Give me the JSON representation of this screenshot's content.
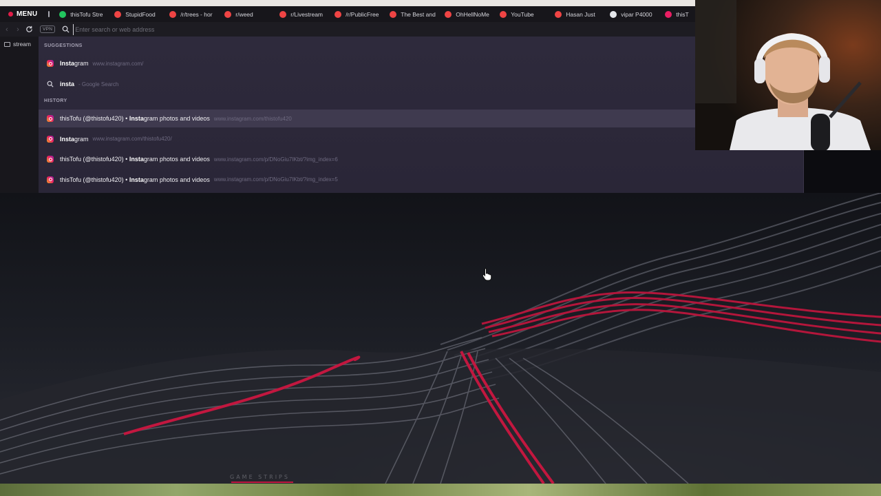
{
  "browser": {
    "menu_label": "MENU",
    "tabs": [
      {
        "title": "thisTofu Stre",
        "favicon": "twitch-icon",
        "color": "#22c55e"
      },
      {
        "title": "StupidFood",
        "favicon": "reddit-icon",
        "color": "#ef4444"
      },
      {
        "title": "/r/trees - hor",
        "favicon": "reddit-icon",
        "color": "#ef4444"
      },
      {
        "title": "r/weed",
        "favicon": "reddit-icon",
        "color": "#ef4444"
      },
      {
        "title": "r/Livestream",
        "favicon": "reddit-icon",
        "color": "#ef4444"
      },
      {
        "title": "/r/PublicFree",
        "favicon": "reddit-icon",
        "color": "#ef4444"
      },
      {
        "title": "The Best and",
        "favicon": "reddit-icon",
        "color": "#ef4444"
      },
      {
        "title": "OhHellNoMe",
        "favicon": "reddit-icon",
        "color": "#ef4444"
      },
      {
        "title": "YouTube",
        "favicon": "youtube-icon",
        "color": "#ef4444"
      },
      {
        "title": "Hasan Just",
        "favicon": "youtube-icon",
        "color": "#ef4444"
      },
      {
        "title": "vipar P4000",
        "favicon": "google-icon",
        "color": "#e5e7eb"
      },
      {
        "title": "thisT",
        "favicon": "instagram-icon",
        "color": "#e91e63"
      }
    ],
    "address": {
      "vpn_label": "VPN",
      "placeholder": "Enter search or web address",
      "value": ""
    },
    "sidebar": {
      "bookmark_label": "stream"
    }
  },
  "dropdown": {
    "suggestions_header": "SUGGESTIONS",
    "history_header": "HISTORY",
    "suggestions": [
      {
        "bold": "Insta",
        "rest": "gram",
        "url": "www.instagram.com/",
        "icon": "instagram-icon"
      },
      {
        "bold": "insta",
        "rest": "",
        "url": "- Google Search",
        "icon": "search-icon"
      }
    ],
    "history": [
      {
        "pre": "thisTofu (@thistofu420) • ",
        "bold": "Insta",
        "rest": "gram photos and videos",
        "url": "www.instagram.com/thistofu420",
        "icon": "instagram-icon",
        "highlighted": true
      },
      {
        "pre": "",
        "bold": "Insta",
        "rest": "gram",
        "url": "www.instagram.com/thistofu420/",
        "icon": "instagram-icon",
        "highlighted": false
      },
      {
        "pre": "thisTofu (@thistofu420) • ",
        "bold": "Insta",
        "rest": "gram photos and videos",
        "url": "www.instagram.com/p/DNoGiu7IKbt/?img_index=6",
        "icon": "instagram-icon",
        "highlighted": false
      },
      {
        "pre": "thisTofu (@thistofu420) • ",
        "bold": "Insta",
        "rest": "gram photos and videos",
        "url": "www.instagram.com/p/DNoGiu7IKbt/?img_index=5",
        "icon": "instagram-icon",
        "highlighted": false
      }
    ]
  },
  "desktop": {
    "wallpaper_caption": "GAME STRIPS",
    "accent_color": "#c2173f"
  }
}
